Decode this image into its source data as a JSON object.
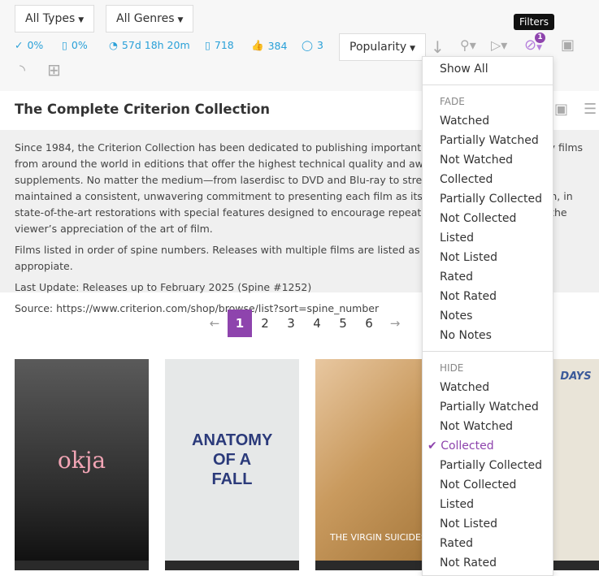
{
  "filters": {
    "types": "All Types",
    "genres": "All Genres"
  },
  "stats": {
    "watched": "0%",
    "collected": "0%",
    "runtime": "57d 18h 20m",
    "count": "718",
    "likes": "384",
    "comments": "3"
  },
  "sort": {
    "label": "Popularity"
  },
  "tooltip": "Filters",
  "filter_badge": "1",
  "list": {
    "title": "The Complete Criterion Collection",
    "description": [
      "Since 1984, the Criterion Collection has been dedicated to publishing important classic and contemporary films from around the world in editions that offer the highest technical quality and award-winning, original supplements. No matter the medium—from laserdisc to DVD and Blu-ray to streaming—Criterion has maintained a consistent, unwavering commitment to presenting each film as its maker would want it seen, in state-of-the-art restorations with special features designed to encourage repeated watching and deepen the viewer’s appreciation of the art of film.",
      "Films listed in order of spine numbers. Releases with multiple films are listed as individual films where appropiate.",
      "Last Update: Releases up to February 2025 (Spine #1252)",
      "Source: https://www.criterion.com/shop/browse/list?sort=spine_number"
    ]
  },
  "pagination": {
    "prev": "←",
    "pages": [
      "1",
      "2",
      "3",
      "4",
      "5",
      "6"
    ],
    "next": "→",
    "current": "1"
  },
  "posters": [
    {
      "title": "okja"
    },
    {
      "title": "ANATOMY OF A FALL"
    },
    {
      "title": "THE VIRGIN SUICIDES"
    },
    {
      "title": "DAYS"
    }
  ],
  "dropdown": {
    "show_all": "Show All",
    "fade_header": "FADE",
    "fade": [
      "Watched",
      "Partially Watched",
      "Not Watched",
      "Collected",
      "Partially Collected",
      "Not Collected",
      "Listed",
      "Not Listed",
      "Rated",
      "Not Rated",
      "Notes",
      "No Notes"
    ],
    "hide_header": "HIDE",
    "hide": [
      "Watched",
      "Partially Watched",
      "Not Watched",
      "Collected",
      "Partially Collected",
      "Not Collected",
      "Listed",
      "Not Listed",
      "Rated",
      "Not Rated"
    ],
    "hide_checked": "Collected",
    "accent": "#8e44ad"
  }
}
